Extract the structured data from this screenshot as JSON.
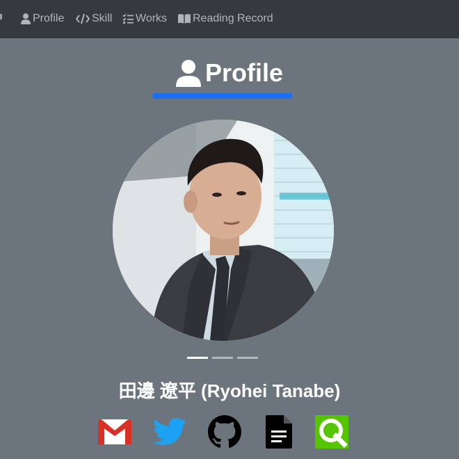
{
  "nav": {
    "items": [
      {
        "label": "Profile",
        "icon": "user-icon"
      },
      {
        "label": "Skill",
        "icon": "code-icon"
      },
      {
        "label": "Works",
        "icon": "tasks-icon"
      },
      {
        "label": "Reading Record",
        "icon": "book-icon"
      }
    ]
  },
  "section": {
    "title": "Profile",
    "icon": "user-icon",
    "accent_color": "#1a6ff5"
  },
  "carousel": {
    "slide_count": 3,
    "active_index": 0
  },
  "person": {
    "name": "田邊 遼平 (Ryohei Tanabe)"
  },
  "social_links": [
    {
      "name": "gmail",
      "icon": "gmail-icon"
    },
    {
      "name": "twitter",
      "icon": "twitter-icon"
    },
    {
      "name": "github",
      "icon": "github-icon"
    },
    {
      "name": "document",
      "icon": "document-icon"
    },
    {
      "name": "qiita",
      "icon": "qiita-icon"
    }
  ],
  "colors": {
    "navbar_bg": "#343a40",
    "page_bg": "#6c757d",
    "twitter_blue": "#1da1f2",
    "qiita_green": "#55c500",
    "gmail_red": "#d93025"
  }
}
